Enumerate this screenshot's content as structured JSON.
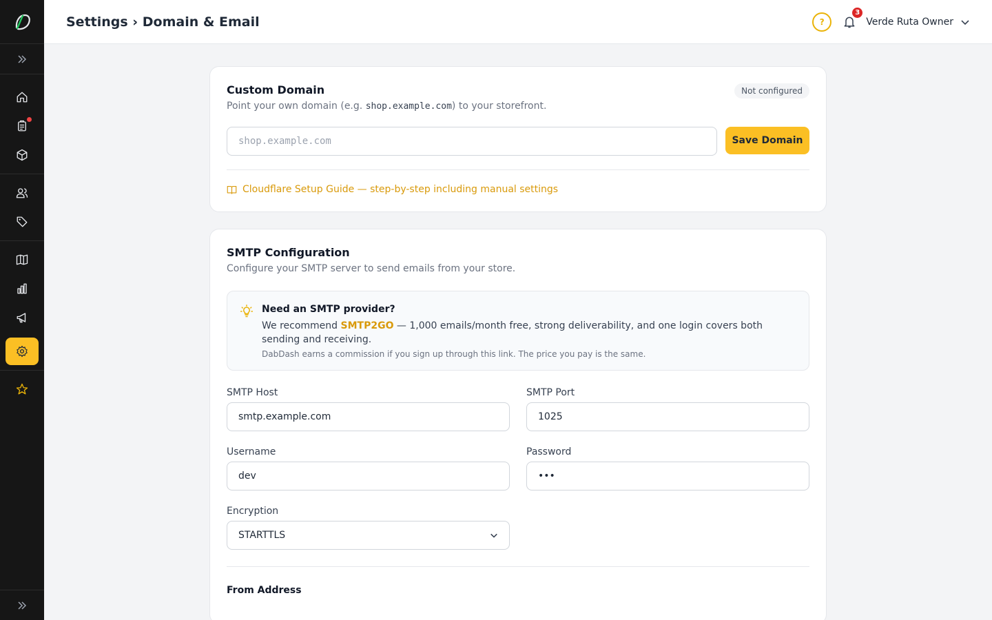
{
  "header": {
    "title": "Settings › Domain & Email",
    "user_name": "Verde Ruta Owner",
    "notification_count": "3",
    "help_glyph": "?"
  },
  "sidebar": {
    "items": [
      {
        "name": "home",
        "icon": "home-icon"
      },
      {
        "name": "orders",
        "icon": "clipboard-icon",
        "has_dot": true
      },
      {
        "name": "products",
        "icon": "box-icon"
      },
      {
        "name": "customers",
        "icon": "users-icon"
      },
      {
        "name": "discounts",
        "icon": "tag-icon"
      },
      {
        "name": "guide",
        "icon": "map-icon"
      },
      {
        "name": "analytics",
        "icon": "bar-chart-icon"
      },
      {
        "name": "marketing",
        "icon": "megaphone-icon"
      },
      {
        "name": "settings",
        "icon": "gear-icon",
        "active": true
      },
      {
        "name": "favorites",
        "icon": "star-icon"
      }
    ],
    "accent_color": "#fbbf24"
  },
  "custom_domain": {
    "title": "Custom Domain",
    "subtitle_before": "Point your own domain (e.g. ",
    "subtitle_code": "shop.example.com",
    "subtitle_after": ") to your storefront.",
    "status": "Not configured",
    "input_placeholder": "shop.example.com",
    "save_label": "Save Domain",
    "guide_link": "Cloudflare Setup Guide — step-by-step including manual settings"
  },
  "smtp": {
    "title": "SMTP Configuration",
    "subtitle": "Configure your SMTP server to send emails from your store.",
    "callout": {
      "title": "Need an SMTP provider?",
      "text_before": "We recommend ",
      "link": "SMTP2GO",
      "text_after": " — 1,000 emails/month free, strong deliverability, and one login covers both sending and receiving.",
      "note": "DabDash earns a commission if you sign up through this link. The price you pay is the same."
    },
    "host_label": "SMTP Host",
    "host_value": "smtp.example.com",
    "port_label": "SMTP Port",
    "port_value": "1025",
    "username_label": "Username",
    "username_value": "dev",
    "password_label": "Password",
    "password_value": "•••",
    "encryption_label": "Encryption",
    "encryption_value": "STARTTLS",
    "from_section_title": "From Address"
  }
}
